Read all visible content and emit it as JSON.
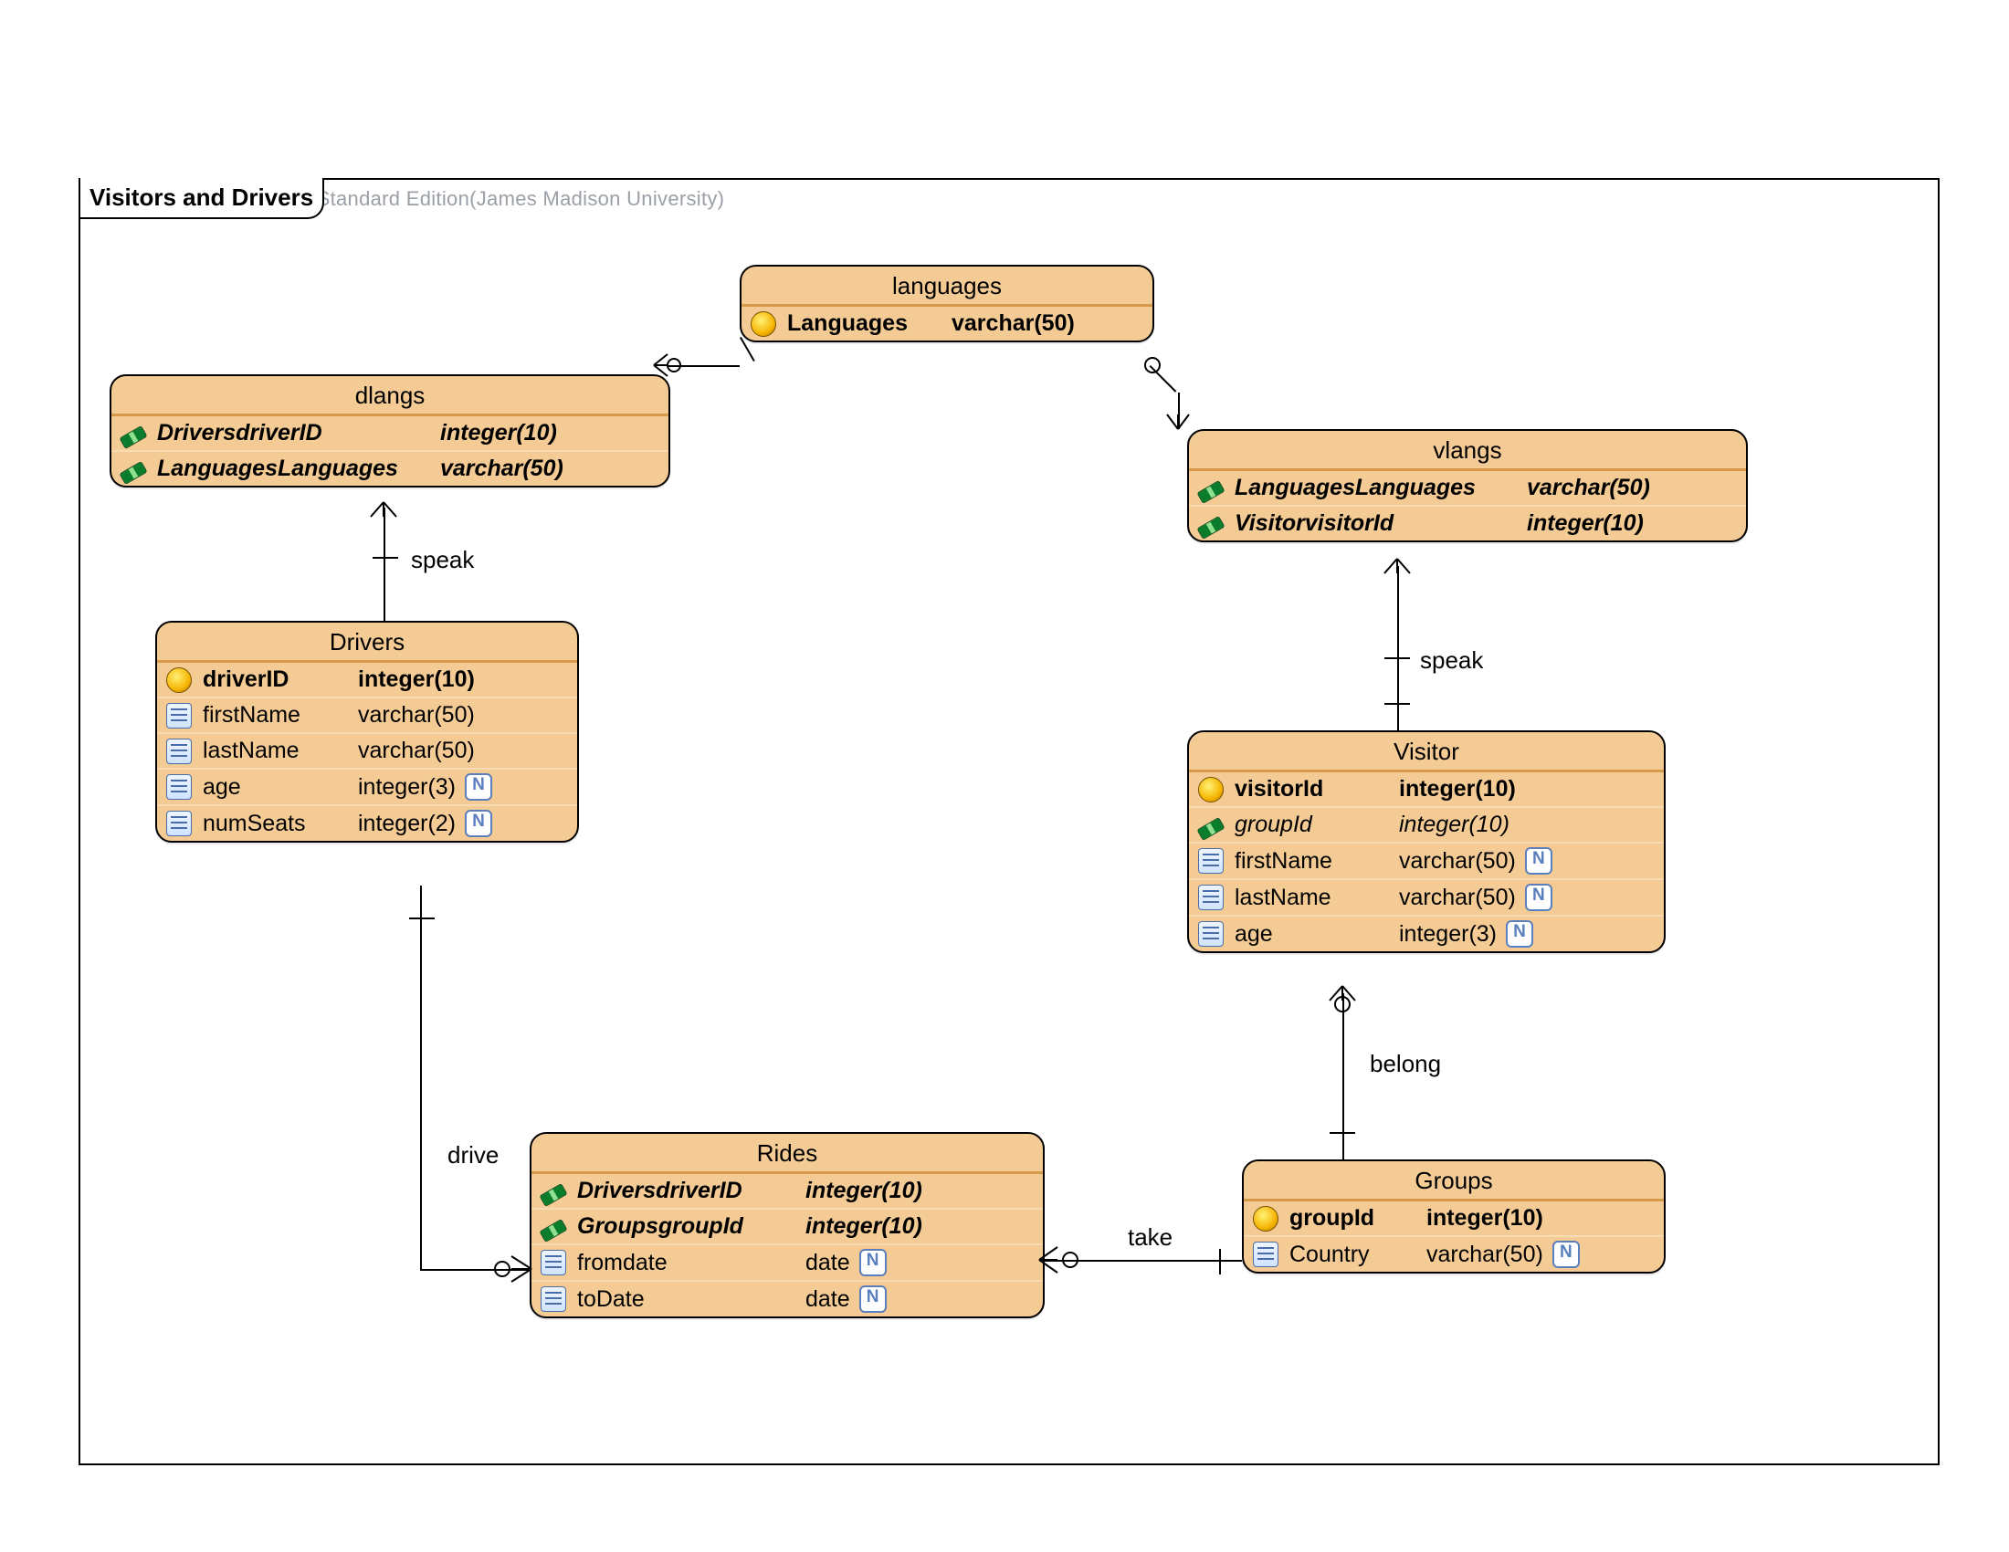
{
  "frame_title": "Visitors and Drivers",
  "watermark": "Visual Paradigm for UML Standard Edition(James Madison University)",
  "nullable_badge": "N",
  "labels": {
    "speak1": "speak",
    "speak2": "speak",
    "drive": "drive",
    "take": "take",
    "belong": "belong"
  },
  "entities": {
    "languages": {
      "title": "languages",
      "rows": [
        {
          "icon": "pk",
          "name": "Languages",
          "type": "varchar(50)",
          "bold": true
        }
      ]
    },
    "dlangs": {
      "title": "dlangs",
      "rows": [
        {
          "icon": "fk",
          "name": "DriversdriverID",
          "type": "integer(10)",
          "bold": true,
          "ital": true
        },
        {
          "icon": "fk",
          "name": "LanguagesLanguages",
          "type": "varchar(50)",
          "bold": true,
          "ital": true
        }
      ]
    },
    "vlangs": {
      "title": "vlangs",
      "rows": [
        {
          "icon": "fk",
          "name": "LanguagesLanguages",
          "type": "varchar(50)",
          "bold": true,
          "ital": true
        },
        {
          "icon": "fk",
          "name": "VisitorvisitorId",
          "type": "integer(10)",
          "bold": true,
          "ital": true
        }
      ]
    },
    "drivers": {
      "title": "Drivers",
      "rows": [
        {
          "icon": "pk",
          "name": "driverID",
          "type": "integer(10)",
          "bold": true
        },
        {
          "icon": "col",
          "name": "firstName",
          "type": "varchar(50)"
        },
        {
          "icon": "col",
          "name": "lastName",
          "type": "varchar(50)"
        },
        {
          "icon": "col",
          "name": "age",
          "type": "integer(3)",
          "nullable": true
        },
        {
          "icon": "col",
          "name": "numSeats",
          "type": "integer(2)",
          "nullable": true
        }
      ]
    },
    "visitor": {
      "title": "Visitor",
      "rows": [
        {
          "icon": "pk",
          "name": "visitorId",
          "type": "integer(10)",
          "bold": true
        },
        {
          "icon": "fk",
          "name": "groupId",
          "type": "integer(10)",
          "ital": true
        },
        {
          "icon": "col",
          "name": "firstName",
          "type": "varchar(50)",
          "nullable": true
        },
        {
          "icon": "col",
          "name": "lastName",
          "type": "varchar(50)",
          "nullable": true
        },
        {
          "icon": "col",
          "name": "age",
          "type": "integer(3)",
          "nullable": true
        }
      ]
    },
    "rides": {
      "title": "Rides",
      "rows": [
        {
          "icon": "fk",
          "name": "DriversdriverID",
          "type": "integer(10)",
          "bold": true,
          "ital": true
        },
        {
          "icon": "fk",
          "name": "GroupsgroupId",
          "type": "integer(10)",
          "bold": true,
          "ital": true
        },
        {
          "icon": "col",
          "name": "fromdate",
          "type": "date",
          "nullable": true
        },
        {
          "icon": "col",
          "name": "toDate",
          "type": "date",
          "nullable": true
        }
      ]
    },
    "groups": {
      "title": "Groups",
      "rows": [
        {
          "icon": "pk",
          "name": "groupId",
          "type": "integer(10)",
          "bold": true
        },
        {
          "icon": "col",
          "name": "Country",
          "type": "varchar(50)",
          "nullable": true
        }
      ]
    }
  }
}
